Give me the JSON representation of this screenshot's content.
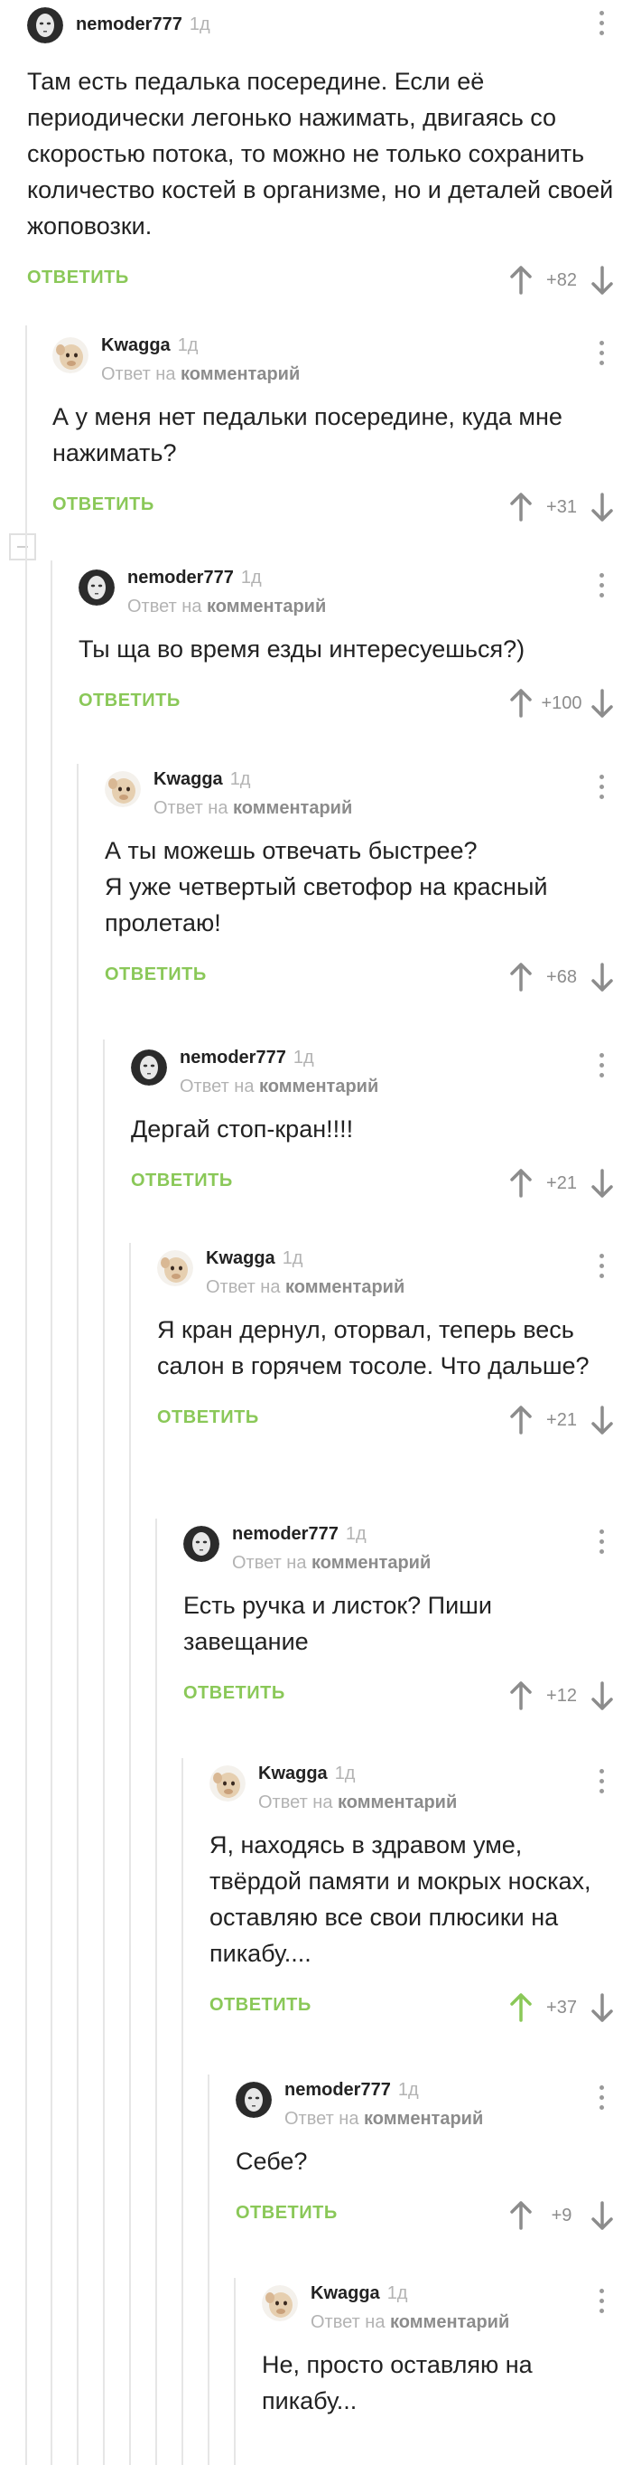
{
  "reply_to_prefix": "Ответ на",
  "reply_to_link": "комментарий",
  "reply_label": "ОТВЕТИТЬ",
  "comments": [
    {
      "author": "nemoder777",
      "time": "1д",
      "text": "Там есть педалька посередине. Если её периодически легонько нажимать, двигаясь со скоростью потока, то можно не только сохранить количество костей в организме, но и деталей своей жоповозки.",
      "rating": "+82",
      "is_reply": false,
      "upvoted": false
    },
    {
      "author": "Kwagga",
      "time": "1д",
      "text": "А у меня нет педальки посередине, куда мне нажимать?",
      "rating": "+31",
      "is_reply": true,
      "upvoted": false
    },
    {
      "author": "nemoder777",
      "time": "1д",
      "text": "Ты ща во время езды интересуешься?)",
      "rating": "+100",
      "is_reply": true,
      "upvoted": false
    },
    {
      "author": "Kwagga",
      "time": "1д",
      "text": "А ты можешь отвечать быстрее?\nЯ уже четвертый светофор на красный пролетаю!",
      "rating": "+68",
      "is_reply": true,
      "upvoted": false
    },
    {
      "author": "nemoder777",
      "time": "1д",
      "text": "Дергай стоп-кран!!!!",
      "rating": "+21",
      "is_reply": true,
      "upvoted": false
    },
    {
      "author": "Kwagga",
      "time": "1д",
      "text": "Я кран дернул, оторвал, теперь весь салон в горячем тосоле. Что дальше?",
      "rating": "+21",
      "is_reply": true,
      "upvoted": false
    },
    {
      "author": "nemoder777",
      "time": "1д",
      "text": "Есть ручка и листок? Пиши завещание",
      "rating": "+12",
      "is_reply": true,
      "upvoted": false
    },
    {
      "author": "Kwagga",
      "time": "1д",
      "text": "Я, находясь в здравом уме, твёрдой памяти и мокрых носках, оставляю все свои плюсики на пикабу....",
      "rating": "+37",
      "is_reply": true,
      "upvoted": true
    },
    {
      "author": "nemoder777",
      "time": "1д",
      "text": "Себе?",
      "rating": "+9",
      "is_reply": true,
      "upvoted": false
    },
    {
      "author": "Kwagga",
      "time": "1д",
      "text": "Не, просто оставляю на пикабу...",
      "rating": "",
      "is_reply": true,
      "upvoted": false
    }
  ],
  "colors": {
    "accent": "#8ac858",
    "muted": "#b3b3b3",
    "text": "#222222"
  }
}
